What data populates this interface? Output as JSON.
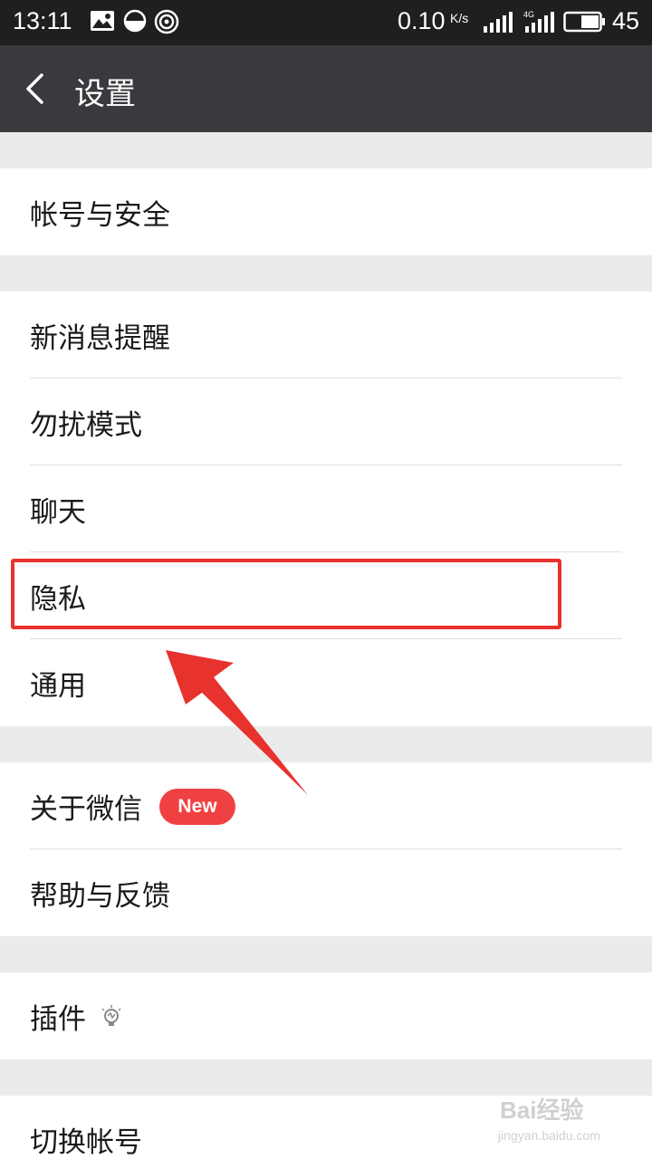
{
  "status_bar": {
    "time": "13:11",
    "net_speed": "0.10",
    "net_speed_unit": "K/s",
    "network_type": "4G",
    "battery_percent": "45",
    "icons": [
      "image-icon",
      "data-saver-icon",
      "hotspot-icon",
      "signal-icon",
      "signal-4g-icon",
      "battery-icon"
    ]
  },
  "header": {
    "title": "设置",
    "back_icon": "back-chevron-icon"
  },
  "groups": [
    {
      "items": [
        {
          "label": "帐号与安全"
        }
      ]
    },
    {
      "items": [
        {
          "label": "新消息提醒"
        },
        {
          "label": "勿扰模式"
        },
        {
          "label": "聊天"
        },
        {
          "label": "隐私"
        },
        {
          "label": "通用"
        }
      ]
    },
    {
      "items": [
        {
          "label": "关于微信",
          "badge": "New"
        },
        {
          "label": "帮助与反馈"
        }
      ]
    },
    {
      "items": [
        {
          "label": "插件",
          "icon": "lightbulb-icon"
        }
      ]
    },
    {
      "items": [
        {
          "label": "切换帐号"
        }
      ]
    }
  ],
  "annotation": {
    "highlight_color": "#e8322e",
    "highlighted_item": "隐私"
  },
  "watermark": {
    "logo": "Bai经验",
    "url": "jingyan.baidu.com"
  },
  "colors": {
    "status_bar_bg": "#1f1f1f",
    "title_bar_bg": "#393a3e",
    "page_bg": "#ebebeb",
    "badge_bg": "#f04142"
  }
}
